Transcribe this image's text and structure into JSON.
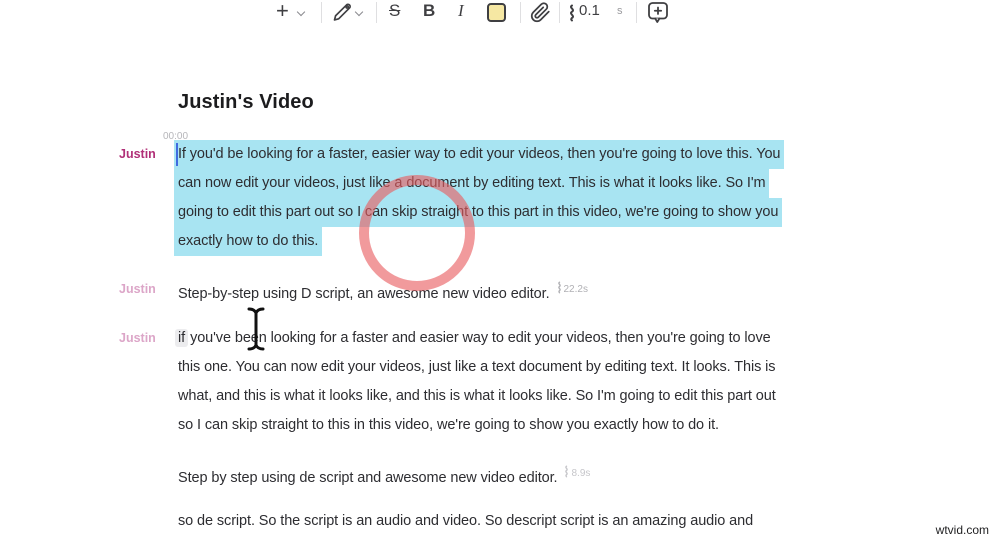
{
  "toolbar": {
    "insert_label": "+",
    "strikethrough_label": "S",
    "bold_label": "B",
    "italic_label": "I",
    "speed_value": "0.1",
    "seconds_label": "s",
    "icons": [
      "plus-icon",
      "chevron-down-icon",
      "pen-icon",
      "strikethrough-icon",
      "bold-icon",
      "italic-icon",
      "highlight-swatch-icon",
      "paperclip-icon",
      "word-gap-squiggle-icon",
      "comment-add-icon"
    ]
  },
  "doc": {
    "title": "Justin's Video",
    "timestamp": "00:00",
    "p1": {
      "speaker": "Justin",
      "lines": [
        "If you'd be looking for a faster, easier way to edit your videos, then you're going to love this. You",
        "can now edit your videos, just like a document by editing text. This is what it looks like. So I'm",
        "going to edit this part out so I can skip straight to this part in this video, we're going to show you",
        "exactly how to do this."
      ]
    },
    "p2": {
      "speaker": "Justin",
      "text": "Step-by-step using D script, an awesome new video editor.",
      "duration": "22.2s"
    },
    "p3": {
      "speaker": "Justin",
      "line1_word": "if",
      "line1_rest": "you've been looking for a faster and easier way to edit your videos, then you're going to love",
      "line2": "this one. You can now edit your videos, just like a text document by editing text. It looks. This is",
      "line3": "what, and this is what it looks like, and this is what it looks like. So I'm going to edit this part out",
      "line4": "so I can skip straight to this in this video, we're going to show you exactly how to do it."
    },
    "p4": {
      "text": "Step by step using de script and awesome new video editor.",
      "duration": "8.9s"
    },
    "p5": {
      "text": "so de script. So the script is an audio and video. So descript script is an amazing audio and"
    },
    "colors": {
      "highlight": "#a8e4f2",
      "speaker_active": "#b13078",
      "speaker_muted": "#dca6c8",
      "annotation_circle": "#e85c5f",
      "caret": "#3f6be0"
    }
  },
  "watermark": "wtvid.com"
}
